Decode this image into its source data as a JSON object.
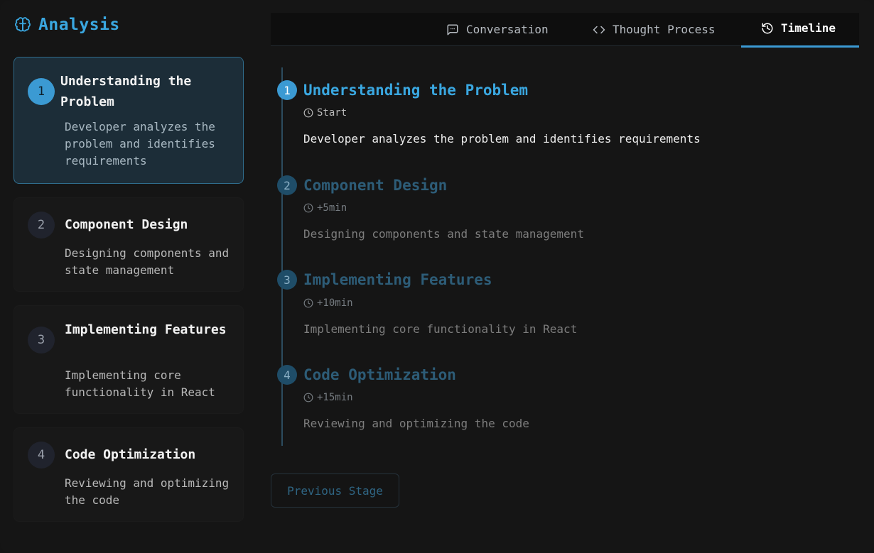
{
  "brand": {
    "title": "Analysis",
    "icon": "brain-icon",
    "accent": "#3aa7e0"
  },
  "tabs": [
    {
      "label": "Conversation",
      "icon": "message-square-icon",
      "active": false
    },
    {
      "label": "Thought Process",
      "icon": "code-icon",
      "active": false
    },
    {
      "label": "Timeline",
      "icon": "history-icon",
      "active": true
    }
  ],
  "stages": [
    {
      "number": "1",
      "title": "Understanding the Problem",
      "description": "Developer analyzes the problem and identifies requirements",
      "active": true
    },
    {
      "number": "2",
      "title": "Component Design",
      "description": "Designing components and state management",
      "active": false
    },
    {
      "number": "3",
      "title": "Implementing Features",
      "description": "Implementing core functionality in React",
      "active": false
    },
    {
      "number": "4",
      "title": "Code Optimization",
      "description": "Reviewing and optimizing the code",
      "active": false
    }
  ],
  "timeline": [
    {
      "number": "1",
      "title": "Understanding the Problem",
      "time": "Start",
      "description": "Developer analyzes the problem and identifies requirements"
    },
    {
      "number": "2",
      "title": "Component Design",
      "time": "+5min",
      "description": "Designing components and state management"
    },
    {
      "number": "3",
      "title": "Implementing Features",
      "time": "+10min",
      "description": "Implementing core functionality in React"
    },
    {
      "number": "4",
      "title": "Code Optimization",
      "time": "+15min",
      "description": "Reviewing and optimizing the code"
    }
  ],
  "controls": {
    "previous_label": "Previous Stage"
  }
}
